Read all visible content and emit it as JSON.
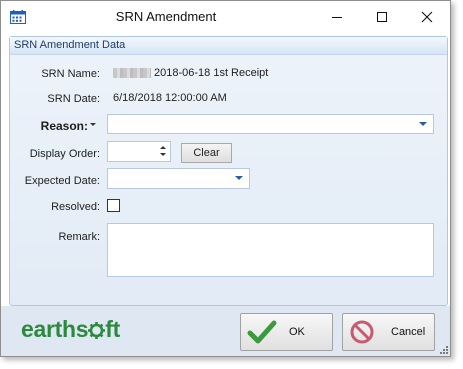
{
  "window": {
    "title": "SRN Amendment"
  },
  "panel": {
    "header": "SRN Amendment Data"
  },
  "form": {
    "srn_name": {
      "label": "SRN Name:",
      "value": "2018-06-18 1st Receipt"
    },
    "srn_date": {
      "label": "SRN Date:",
      "value": "6/18/2018 12:00:00 AM"
    },
    "reason": {
      "label": "Reason:",
      "value": ""
    },
    "display_order": {
      "label": "Display Order:",
      "value": ""
    },
    "clear_label": "Clear",
    "expected_date": {
      "label": "Expected Date:",
      "value": ""
    },
    "resolved": {
      "label": "Resolved:",
      "checked": false
    },
    "remark": {
      "label": "Remark:",
      "value": ""
    }
  },
  "footer": {
    "logo": "earthsoft",
    "ok_label": "OK",
    "cancel_label": "Cancel"
  },
  "colors": {
    "panel_border": "#aec7e7",
    "footer_bg": "#dfe7f2",
    "logo_green": "#2b8a3e",
    "dropdown_arrow": "#2a5aa8"
  }
}
